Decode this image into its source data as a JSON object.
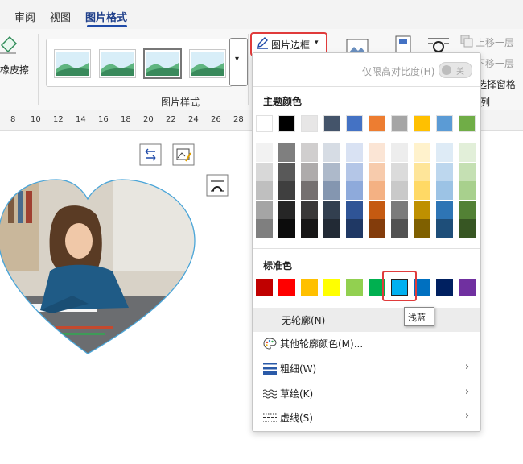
{
  "tabs": [
    {
      "label": "审阅"
    },
    {
      "label": "视图"
    },
    {
      "label": "图片格式",
      "active": true
    }
  ],
  "ribbon": {
    "eraser_label": "橡皮擦",
    "picture_styles_label": "图片样式",
    "border_button_label": "图片边框",
    "bring_forward": "上移一层",
    "send_backward": "下移一层",
    "selection_pane": "选择窗格",
    "arrange_label": "列"
  },
  "ruler": [
    "8",
    "10",
    "12",
    "14",
    "16",
    "18",
    "20",
    "22",
    "24",
    "26",
    "28"
  ],
  "menu": {
    "high_contrast_label": "仅限高对比度(H)",
    "toggle_text": "关",
    "theme_colors_title": "主题颜色",
    "theme_top_colors": [
      "#ffffff",
      "#000000",
      "#e7e6e6",
      "#44546a",
      "#4472c4",
      "#ed7d31",
      "#a5a5a5",
      "#ffc000",
      "#5b9bd5",
      "#70ad47"
    ],
    "theme_shades": [
      [
        "#f2f2f2",
        "#7f7f7f",
        "#d0cece",
        "#d6dce4",
        "#d9e2f3",
        "#fbe5d5",
        "#ededed",
        "#fff2cc",
        "#deebf6",
        "#e2efd9"
      ],
      [
        "#d8d8d8",
        "#595959",
        "#aeabab",
        "#adb9ca",
        "#b4c6e7",
        "#f7cbac",
        "#dbdbdb",
        "#fee599",
        "#bdd7ee",
        "#c5e0b3"
      ],
      [
        "#bfbfbf",
        "#3f3f3f",
        "#757070",
        "#8496b0",
        "#8eaadb",
        "#f4b183",
        "#c9c9c9",
        "#ffd965",
        "#9cc3e5",
        "#a8d08d"
      ],
      [
        "#a5a5a5",
        "#262626",
        "#3a3838",
        "#323f4f",
        "#2f5496",
        "#c55a11",
        "#7b7b7b",
        "#bf9000",
        "#2e75b5",
        "#538135"
      ],
      [
        "#7f7f7f",
        "#0c0c0c",
        "#171616",
        "#222a35",
        "#1f3864",
        "#833c0b",
        "#525252",
        "#7f6000",
        "#1e4e79",
        "#375623"
      ]
    ],
    "standard_colors_title": "标准色",
    "standard_colors": [
      "#c00000",
      "#ff0000",
      "#ffc000",
      "#ffff00",
      "#92d050",
      "#00b050",
      "#00b0f0",
      "#0070c0",
      "#002060",
      "#7030a0"
    ],
    "tooltip": "浅蓝",
    "no_outline": "无轮廓(N)",
    "more_colors": "其他轮廓颜色(M)...",
    "weight": "粗细(W)",
    "sketch": "草绘(K)",
    "dashes": "虚线(S)"
  }
}
